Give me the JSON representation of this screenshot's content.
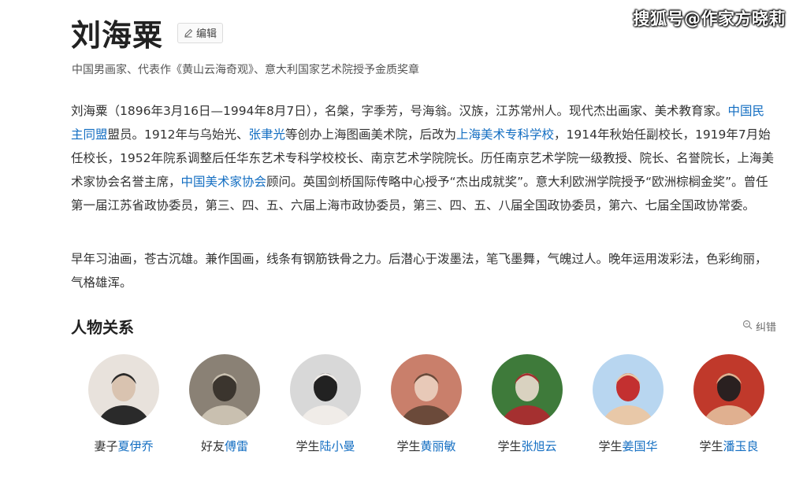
{
  "watermark": "搜狐号@作家方晓莉",
  "header": {
    "title": "刘海粟",
    "edit_label": "编辑"
  },
  "subtitle": "中国男画家、代表作《黄山云海奇观》、意大利国家艺术院授予金质奖章",
  "paragraph1": [
    {
      "text": "刘海粟（1896年3月16日—1994年8月7日），名槃，字季芳，号海翁。汉族，江苏常州人。现代杰出画家、美术教育家。"
    },
    {
      "text": "中国民主同盟",
      "link": true
    },
    {
      "text": "盟员。1912年与乌始光、"
    },
    {
      "text": "张聿光",
      "link": true
    },
    {
      "text": "等创办上海图画美术院，后改为"
    },
    {
      "text": "上海美术专科学校",
      "link": true
    },
    {
      "text": "，1914年秋始任副校长，1919年7月始任校长，1952年院系调整后任华东艺术专科学校校长、南京艺术学院院长。历任南京艺术学院一级教授、院长、名誉院长，上海美术家协会名誉主席，"
    },
    {
      "text": "中国美术家协会",
      "link": true
    },
    {
      "text": "顾问。英国剑桥国际传略中心授予“杰出成就奖”。意大利欧洲学院授予“欧洲棕榈金奖”。曾任第一届江苏省政协委员，第三、四、五、六届上海市政协委员，第三、四、五、八届全国政协委员，第六、七届全国政协常委。"
    }
  ],
  "paragraph2": "早年习油画，苍古沉雄。兼作国画，线条有钢筋铁骨之力。后潜心于泼墨法，笔飞墨舞，气魄过人。晚年运用泼彩法，色彩绚丽，气格雄浑。",
  "relations": {
    "title": "人物关系",
    "report_label": "纠错",
    "people": [
      {
        "relation": "妻子",
        "name": "夏伊乔",
        "palette": [
          "#e8e2dc",
          "#d9c3b0",
          "#2a2a2a"
        ]
      },
      {
        "relation": "好友",
        "name": "傅雷",
        "palette": [
          "#8a8175",
          "#3b352e",
          "#c9c0b0"
        ]
      },
      {
        "relation": "学生",
        "name": "陆小曼",
        "palette": [
          "#d8d8d8",
          "#222222",
          "#f0ece8"
        ]
      },
      {
        "relation": "学生",
        "name": "黄丽敏",
        "palette": [
          "#c97f6b",
          "#e8c9b8",
          "#6b4a3a"
        ]
      },
      {
        "relation": "学生",
        "name": "张旭云",
        "palette": [
          "#3e7a3a",
          "#d9d2c0",
          "#a53030"
        ]
      },
      {
        "relation": "学生",
        "name": "姜国华",
        "palette": [
          "#b8d6f0",
          "#c33030",
          "#e8c8a8"
        ]
      },
      {
        "relation": "学生",
        "name": "潘玉良",
        "palette": [
          "#c0392b",
          "#2a2020",
          "#e0b090"
        ]
      }
    ]
  }
}
